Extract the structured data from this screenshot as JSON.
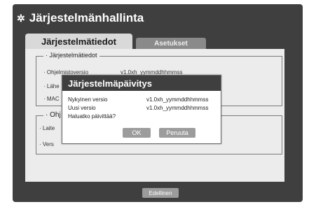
{
  "window": {
    "title": "Järjestelmänhallinta",
    "icon": "gear-icon"
  },
  "tabs": [
    {
      "label": "Järjestelmätiedot",
      "active": true
    },
    {
      "label": "Asetukset",
      "active": false
    }
  ],
  "group1": {
    "legend": "Järjestelmätiedot",
    "rows": [
      {
        "label": "Ohjelmistoversio",
        "value": "v1.0xh_yymmddhhmmss"
      },
      {
        "label": "Lähe",
        "value": ""
      },
      {
        "label": "MAC",
        "value": ""
      }
    ]
  },
  "group2": {
    "legend": "Ohj",
    "rows": [
      {
        "label": "Laite",
        "value": ""
      },
      {
        "label": "Vers",
        "value": ""
      }
    ]
  },
  "footer": {
    "back_label": "Edellinen"
  },
  "dialog": {
    "title": "Järjestelmäpäivitys",
    "current_label": "Nykyinen versio",
    "current_value": "v1.0xh_yymmddhhmmss",
    "new_label": "Uusi versio",
    "new_value": "v1.0xh_yymmddhhmmss",
    "question": "Haluatko päivittää?",
    "ok_label": "OK",
    "cancel_label": "Peruuta"
  }
}
